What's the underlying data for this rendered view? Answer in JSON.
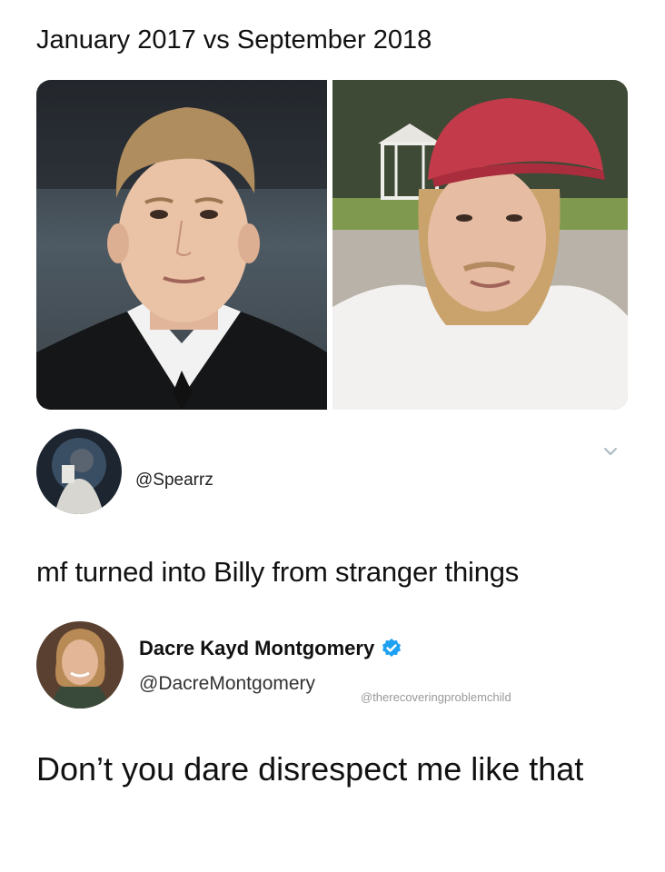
{
  "caption": "January 2017 vs September 2018",
  "tweet1": {
    "handle": "@Spearrz",
    "text": "mf turned into Billy from stranger things"
  },
  "tweet2": {
    "display_name": "Dacre Kayd Montgomery",
    "handle": "@DacreMontgomery",
    "text": "Don’t you dare disrespect me like that"
  },
  "watermark": "@therecoveringproblemchild",
  "icons": {
    "menu": "chevron-down-icon",
    "verified": "verified-badge-icon"
  },
  "colors": {
    "verified_blue": "#1da1f2",
    "text": "#111111",
    "secondary": "#333333"
  }
}
